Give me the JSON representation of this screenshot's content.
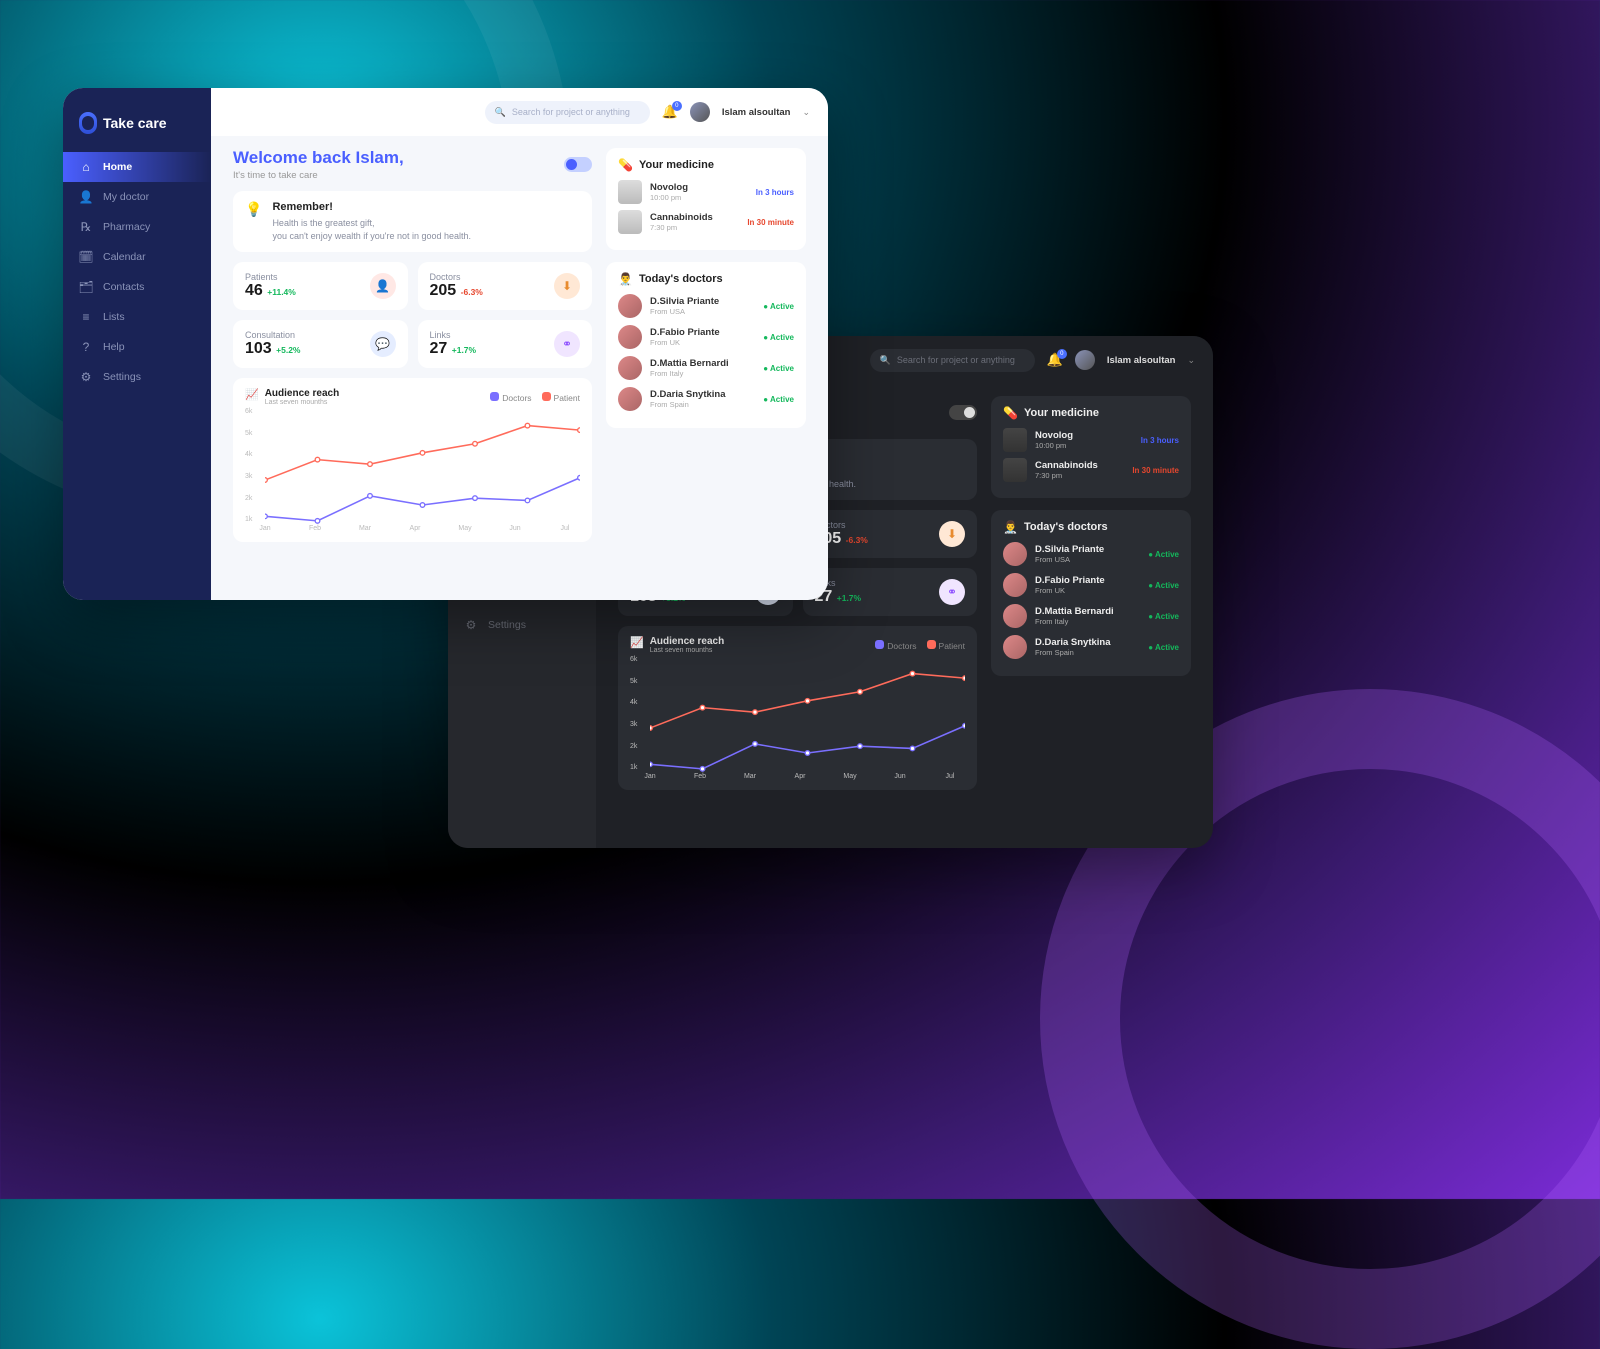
{
  "brand": "Take care",
  "search_placeholder": "Search for project or anything",
  "notif_count": "0",
  "user": "Islam alsoultan",
  "sidebar": {
    "items": [
      {
        "icon": "⌂",
        "label": "Home",
        "active": true
      },
      {
        "icon": "👤",
        "label": "My doctor"
      },
      {
        "icon": "℞",
        "label": "Pharmacy"
      },
      {
        "icon": "🗓",
        "label": "Calendar"
      },
      {
        "icon": "🗂",
        "label": "Contacts"
      },
      {
        "icon": "≡",
        "label": "Lists"
      },
      {
        "icon": "?",
        "label": "Help"
      },
      {
        "icon": "⚙",
        "label": "Settings"
      }
    ]
  },
  "welcome": "Welcome back Islam,",
  "welcome_sub": "It's time to take care",
  "remember": {
    "title": "Remember!",
    "line1": "Health is the greatest gift,",
    "line2": "you can't enjoy wealth if you're not in good health."
  },
  "stats": [
    {
      "label": "Patients",
      "value": "46",
      "delta": "+11.4%",
      "dir": "up",
      "iconClass": "ic-pat",
      "icon": "👤"
    },
    {
      "label": "Doctors",
      "value": "205",
      "delta": "-6.3%",
      "dir": "down",
      "iconClass": "ic-doc",
      "icon": "⬇"
    },
    {
      "label": "Consultation",
      "value": "103",
      "delta": "+5.2%",
      "dir": "up",
      "iconClass": "ic-con",
      "icon": "💬"
    },
    {
      "label": "Links",
      "value": "27",
      "delta": "+1.7%",
      "dir": "up",
      "iconClass": "ic-lnk",
      "icon": "⚭"
    }
  ],
  "medicine_title": "Your medicine",
  "medicines": [
    {
      "name": "Novolog",
      "time": "10:00 pm",
      "due": "In 3 hours",
      "dueClass": "due-blue"
    },
    {
      "name": "Cannabinoids",
      "time": "7:30 pm",
      "due": "In 30 minute",
      "dueClass": "due-red"
    }
  ],
  "doctors_title": "Today's doctors",
  "doctors": [
    {
      "name": "D.Silvia Priante",
      "from": "From USA",
      "status": "Active"
    },
    {
      "name": "D.Fabio Priante",
      "from": "From UK",
      "status": "Active"
    },
    {
      "name": "D.Mattia Bernardi",
      "from": "From Italy",
      "status": "Active"
    },
    {
      "name": "D.Daria Snytkina",
      "from": "From Spain",
      "status": "Active"
    }
  ],
  "chart": {
    "title": "Audience reach",
    "sub": "Last seven mounths",
    "legend_doc": "Doctors",
    "legend_pat": "Patient"
  },
  "chart_data": {
    "type": "line",
    "categories": [
      "Jan",
      "Feb",
      "Mar",
      "Apr",
      "May",
      "Jun",
      "Jul"
    ],
    "series": [
      {
        "name": "Doctors",
        "color": "#7a6fff",
        "values": [
          1400,
          1200,
          2300,
          1900,
          2200,
          2100,
          3100
        ]
      },
      {
        "name": "Patient",
        "color": "#ff6b5b",
        "values": [
          3000,
          3900,
          3700,
          4200,
          4600,
          5400,
          5200
        ]
      }
    ],
    "ylim": [
      1000,
      6000
    ],
    "yticks": [
      6000,
      5000,
      4000,
      3000,
      2000,
      1000
    ],
    "ytick_labels": [
      "6k",
      "5k",
      "4k",
      "3k",
      "2k",
      "1k"
    ]
  }
}
